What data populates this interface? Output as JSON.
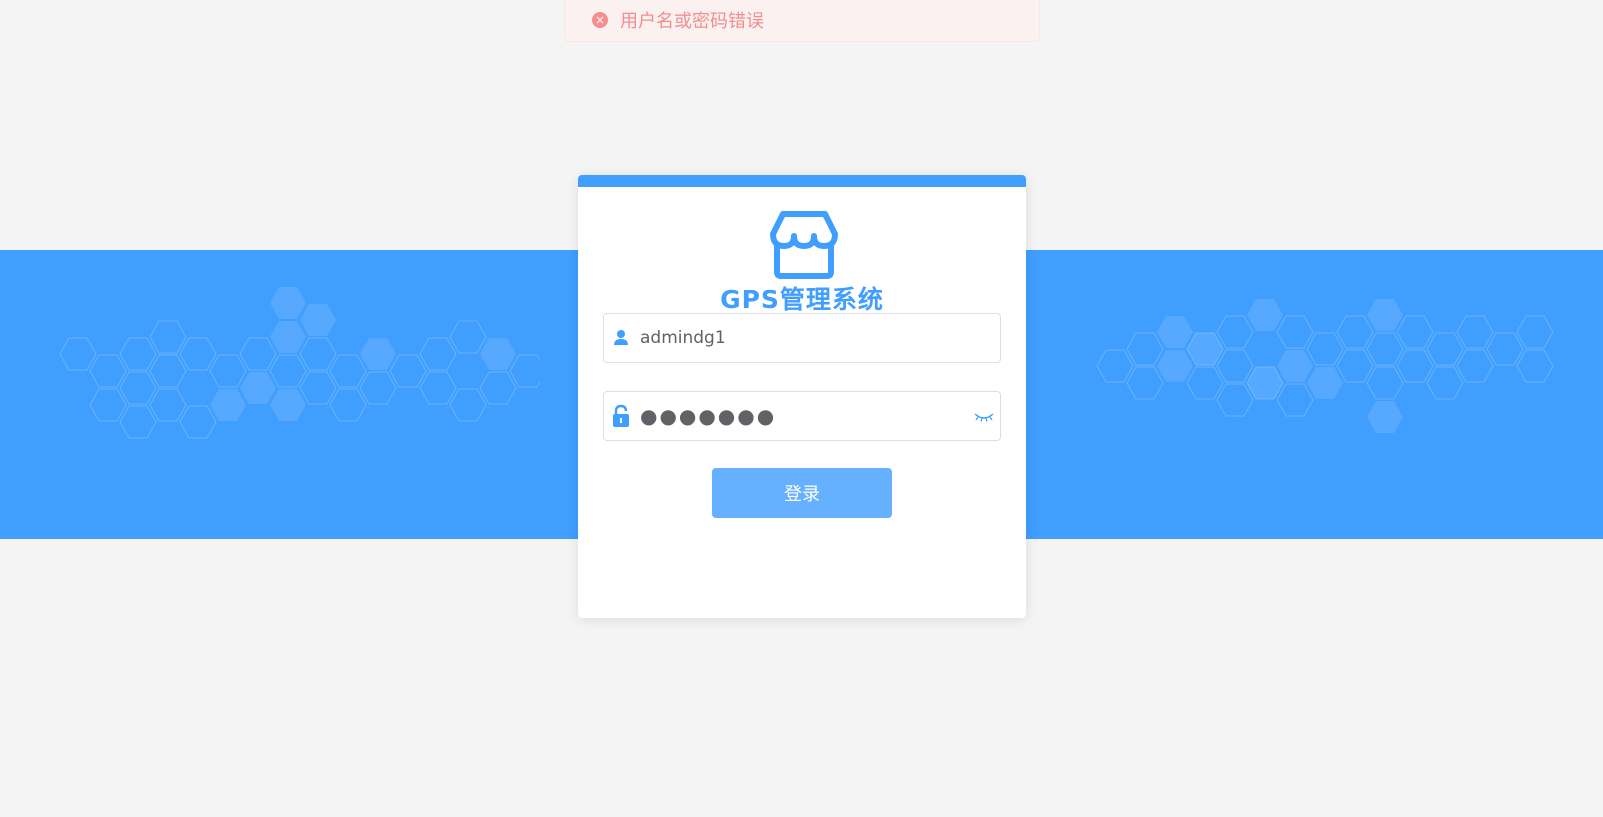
{
  "toast": {
    "icon": "close-circle-icon",
    "message": "用户名或密码错误",
    "color": "#f56c6c"
  },
  "login": {
    "title": "GPS管理系统",
    "logo_icon": "store-icon",
    "username": {
      "icon": "user-icon",
      "value": "admindg1"
    },
    "password": {
      "icon": "lock-icon",
      "value": "●●●●●●●",
      "toggle_icon": "eye-closed-icon"
    },
    "submit_label": "登录"
  },
  "colors": {
    "primary": "#409eff",
    "button_disabled": "#66b1ff",
    "background": "#f4f4f4",
    "error": "#f56c6c"
  }
}
